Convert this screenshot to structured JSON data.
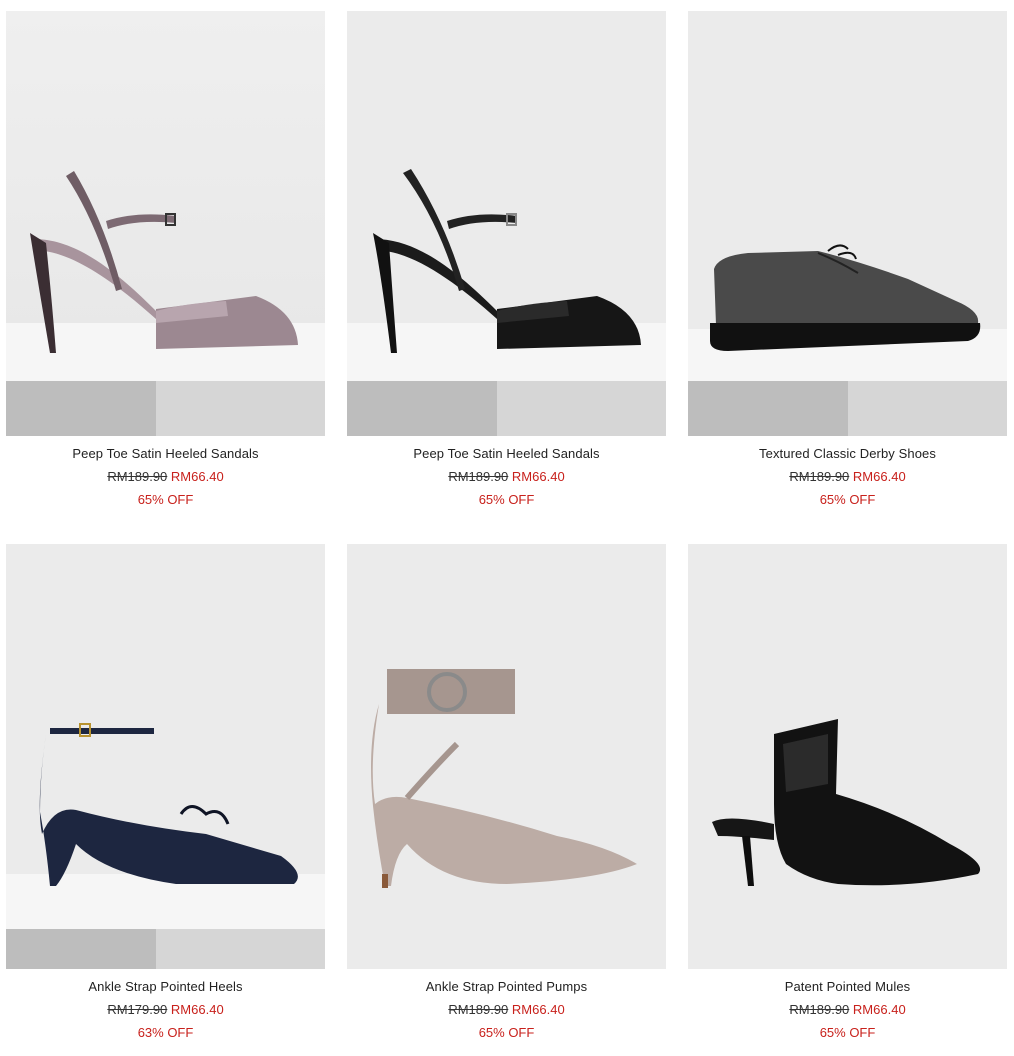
{
  "products": [
    {
      "name": "Peep Toe Satin Heeled Sandals",
      "old_price": "RM189.90",
      "new_price": "RM66.40",
      "discount": "65% OFF",
      "image": "mauve-satin-heeled-sandal"
    },
    {
      "name": "Peep Toe Satin Heeled Sandals",
      "old_price": "RM189.90",
      "new_price": "RM66.40",
      "discount": "65% OFF",
      "image": "black-satin-heeled-sandal"
    },
    {
      "name": "Textured Classic Derby Shoes",
      "old_price": "RM189.90",
      "new_price": "RM66.40",
      "discount": "65% OFF",
      "image": "grey-textured-derby-shoe"
    },
    {
      "name": "Ankle Strap Pointed Heels",
      "old_price": "RM179.90",
      "new_price": "RM66.40",
      "discount": "63% OFF",
      "image": "navy-ankle-strap-heel"
    },
    {
      "name": "Ankle Strap Pointed Pumps",
      "old_price": "RM189.90",
      "new_price": "RM66.40",
      "discount": "65% OFF",
      "image": "taupe-ankle-strap-pump"
    },
    {
      "name": "Patent Pointed Mules",
      "old_price": "RM189.90",
      "new_price": "RM66.40",
      "discount": "65% OFF",
      "image": "black-patent-mule"
    }
  ],
  "colors": {
    "sale": "#c8211c",
    "text": "#222222",
    "photo_bg": "#ececec"
  }
}
